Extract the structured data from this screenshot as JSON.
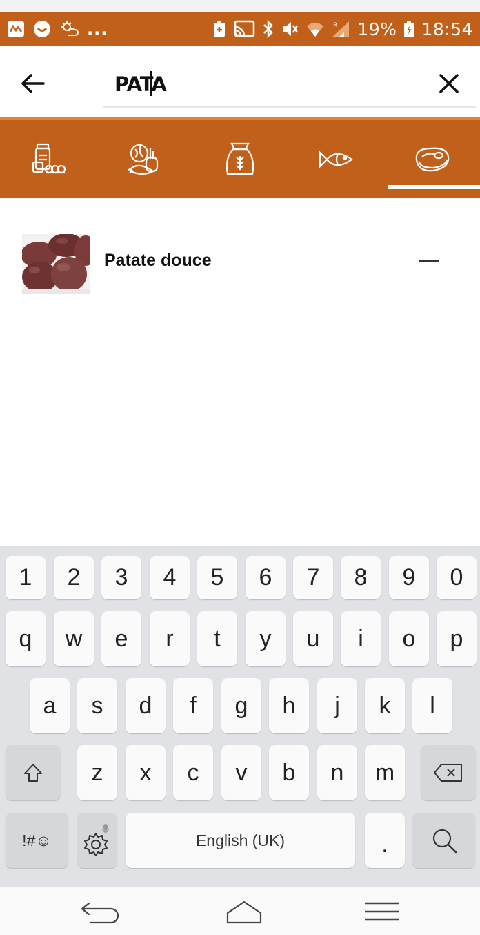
{
  "status_bar": {
    "battery_percent": "19%",
    "time": "18:54",
    "overflow": "...",
    "icons": [
      "app-notification-icon",
      "chat-notification-icon",
      "weather-icon",
      "battery-saver-icon",
      "cast-icon",
      "bluetooth-icon",
      "vibrate-mute-icon",
      "wifi-icon",
      "cellular-signal-icon",
      "battery-charging-icon"
    ],
    "color": "#c0601b"
  },
  "search": {
    "query": "PATA",
    "back_label": "back",
    "clear_label": "clear"
  },
  "categories": {
    "selected_index": 4,
    "items": [
      {
        "icon": "pantry-jar-icon"
      },
      {
        "icon": "vegetables-icon"
      },
      {
        "icon": "grain-sack-icon"
      },
      {
        "icon": "fish-icon"
      },
      {
        "icon": "meat-steak-icon"
      }
    ]
  },
  "results": {
    "items": [
      {
        "name": "Patate douce"
      }
    ]
  },
  "keyboard": {
    "row1": [
      "1",
      "2",
      "3",
      "4",
      "5",
      "6",
      "7",
      "8",
      "9",
      "0"
    ],
    "row2": [
      "q",
      "w",
      "e",
      "r",
      "t",
      "y",
      "u",
      "i",
      "o",
      "p"
    ],
    "row3": [
      "a",
      "s",
      "d",
      "f",
      "g",
      "h",
      "j",
      "k",
      "l"
    ],
    "row4": [
      "z",
      "x",
      "c",
      "v",
      "b",
      "n",
      "m"
    ],
    "symbols_label": "!#☺",
    "space_label": "English (UK)",
    "period_label": "."
  },
  "colors": {
    "accent": "#c0601b",
    "accent_light": "#e8802e",
    "keyboard_bg": "#e1e2e6"
  }
}
